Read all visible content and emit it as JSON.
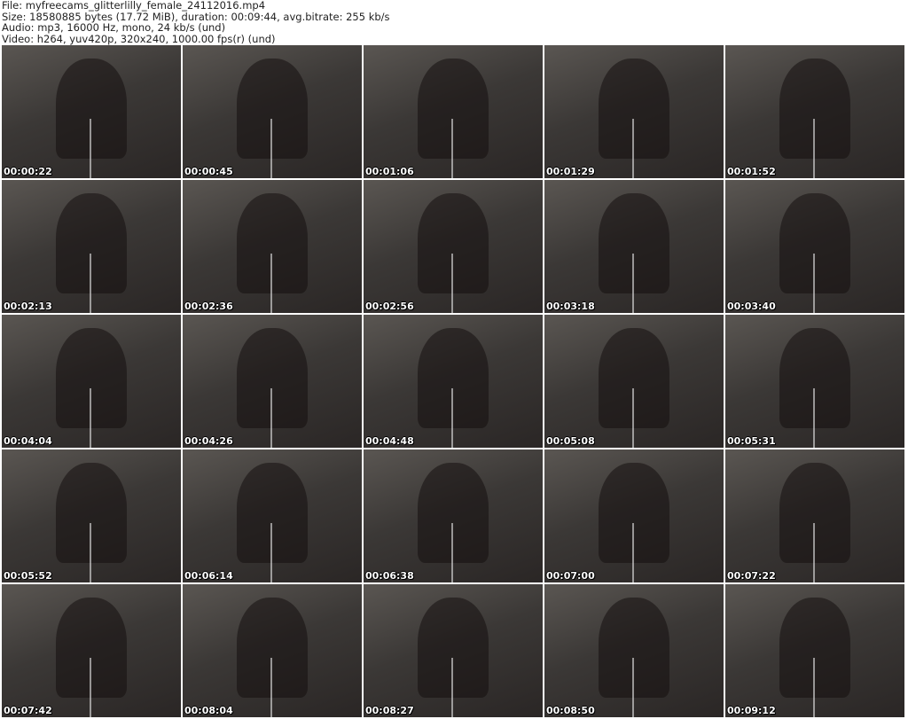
{
  "header": {
    "file": "File: myfreecams_glitterlilly_female_24112016.mp4",
    "size": "Size: 18580885 bytes (17.72 MiB), duration: 00:09:44, avg.bitrate: 255 kb/s",
    "audio": "Audio: mp3, 16000 Hz, mono, 24 kb/s (und)",
    "video": "Video: h264, yuv420p, 320x240, 1000.00 fps(r) (und)"
  },
  "thumbnails": [
    {
      "time": "00:00:22"
    },
    {
      "time": "00:00:45"
    },
    {
      "time": "00:01:06"
    },
    {
      "time": "00:01:29"
    },
    {
      "time": "00:01:52"
    },
    {
      "time": "00:02:13"
    },
    {
      "time": "00:02:36"
    },
    {
      "time": "00:02:56"
    },
    {
      "time": "00:03:18"
    },
    {
      "time": "00:03:40"
    },
    {
      "time": "00:04:04"
    },
    {
      "time": "00:04:26"
    },
    {
      "time": "00:04:48"
    },
    {
      "time": "00:05:08"
    },
    {
      "time": "00:05:31"
    },
    {
      "time": "00:05:52"
    },
    {
      "time": "00:06:14"
    },
    {
      "time": "00:06:38"
    },
    {
      "time": "00:07:00"
    },
    {
      "time": "00:07:22"
    },
    {
      "time": "00:07:42"
    },
    {
      "time": "00:08:04"
    },
    {
      "time": "00:08:27"
    },
    {
      "time": "00:08:50"
    },
    {
      "time": "00:09:12"
    }
  ]
}
